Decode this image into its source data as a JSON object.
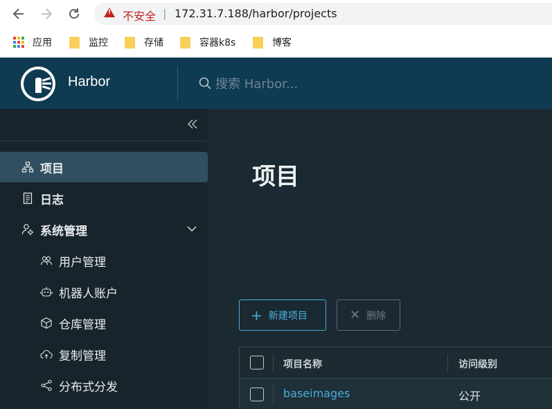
{
  "browser": {
    "security_text": "不安全",
    "separator": "|",
    "url": "172.31.7.188/harbor/projects",
    "bookmarks": [
      {
        "label": "应用",
        "icon": "apps-grid-icon"
      },
      {
        "label": "监控",
        "icon": "folder-icon"
      },
      {
        "label": "存储",
        "icon": "folder-icon"
      },
      {
        "label": "容器k8s",
        "icon": "folder-icon"
      },
      {
        "label": "博客",
        "icon": "folder-icon"
      }
    ]
  },
  "header": {
    "brand": "Harbor",
    "search_placeholder": "搜索 Harbor..."
  },
  "sidebar": {
    "collapse_icon": "double-chevron-left-icon",
    "items": [
      {
        "label": "项目",
        "icon": "project-tree-icon",
        "active": true
      },
      {
        "label": "日志",
        "icon": "log-icon",
        "active": false
      },
      {
        "label": "系统管理",
        "icon": "admin-gear-icon",
        "active": false,
        "expanded": true
      }
    ],
    "sub_items": [
      {
        "label": "用户管理",
        "icon": "users-icon"
      },
      {
        "label": "机器人账户",
        "icon": "robot-icon"
      },
      {
        "label": "仓库管理",
        "icon": "cube-icon"
      },
      {
        "label": "复制管理",
        "icon": "cloud-sync-icon"
      },
      {
        "label": "分布式分发",
        "icon": "share-icon"
      }
    ]
  },
  "main": {
    "title": "项目",
    "new_button": "新建项目",
    "delete_button": "删除",
    "table": {
      "columns": [
        "项目名称",
        "访问级别"
      ],
      "rows": [
        {
          "name": "baseimages",
          "access": "公开"
        }
      ]
    }
  },
  "colors": {
    "header_bg": "#0e3a52",
    "sidebar_bg": "#17242b",
    "active_item_bg": "#324f61",
    "main_bg": "#1b2a32",
    "link": "#4aaed9",
    "warning": "#c5221f"
  }
}
